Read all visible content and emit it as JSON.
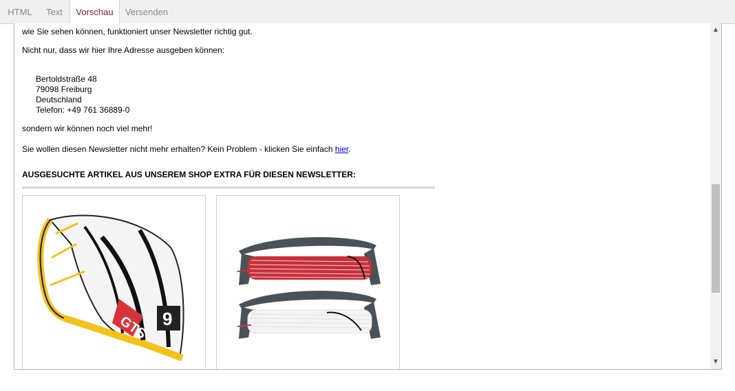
{
  "tabs": [
    {
      "label": "HTML"
    },
    {
      "label": "Text"
    },
    {
      "label": "Vorschau"
    },
    {
      "label": "Versenden"
    }
  ],
  "preview": {
    "line1": "wie Sie sehen können, funktioniert unser Newsletter richtig gut.",
    "line2": "Nicht nur, dass wir hier Ihre Adresse ausgeben können:",
    "address": {
      "street": "Bertoldstraße 48",
      "city": "79098 Freiburg",
      "country": "Deutschland",
      "phone": "Telefon: +49 761 36889-0"
    },
    "line3": "sondern wir können noch viel mehr!",
    "unsubscribe_text": "Sie wollen diesen Newsletter nicht mehr erhalten? Kein Problem - klicken Sie einfach ",
    "unsubscribe_link": "hier",
    "unsubscribe_end": ".",
    "heading": "AUSGESUCHTE ARTIKEL AUS UNSEREM SHOP EXTRA FÜR DIESEN NEWSLETTER:"
  },
  "products": [
    {
      "image": "kite-image",
      "brand_mark": "GTS",
      "size_mark": "9"
    },
    {
      "image": "kite-line-bars-image"
    }
  ],
  "colors": {
    "active_tab": "#7a1f2b",
    "kite_yellow": "#f2c21a",
    "line_red": "#d8333a"
  }
}
